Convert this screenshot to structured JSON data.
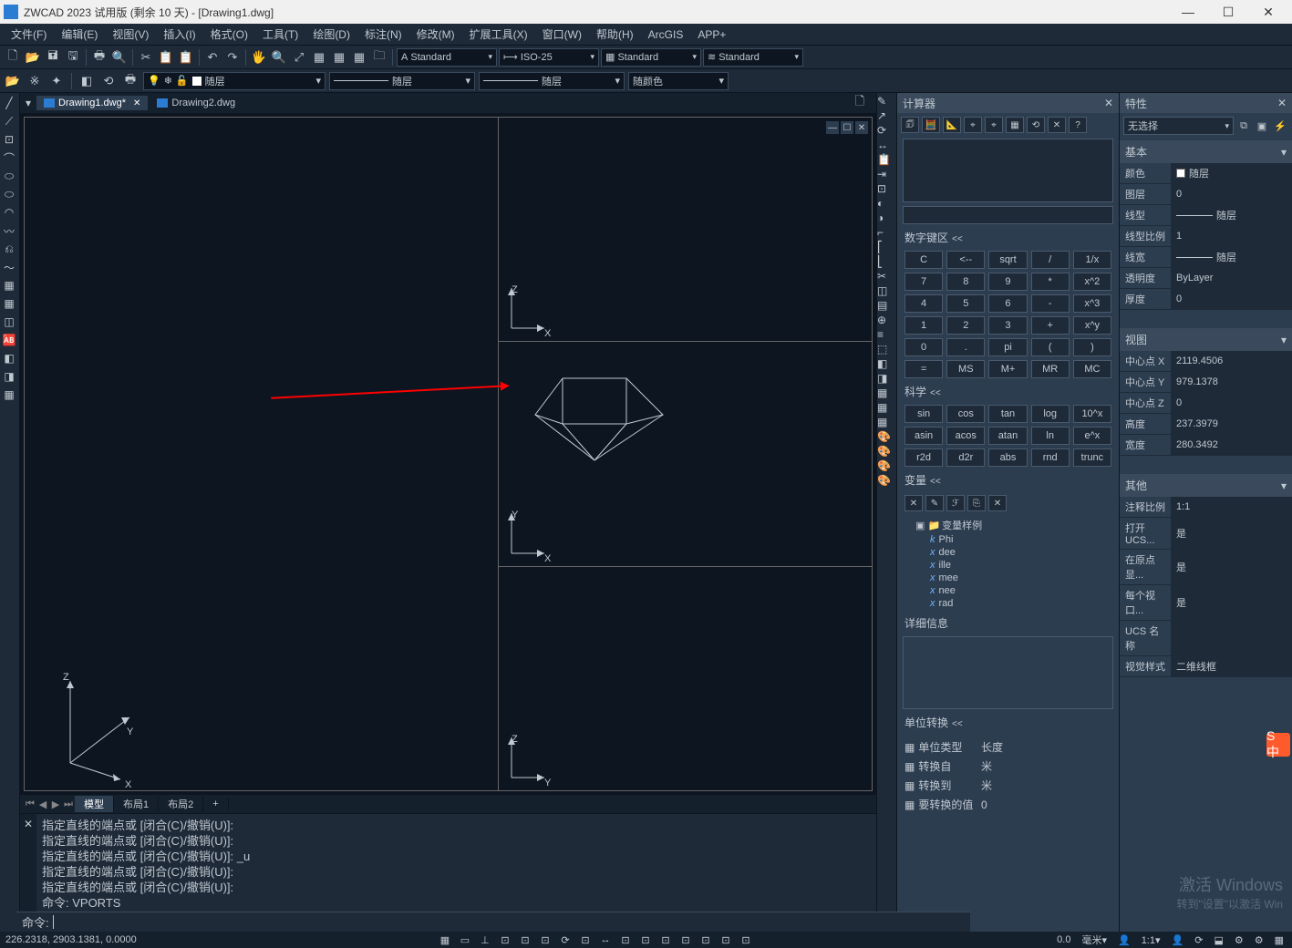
{
  "title": "ZWCAD 2023 试用版 (剩余 10 天) - [Drawing1.dwg]",
  "win_controls": {
    "min": "—",
    "max": "☐",
    "close": "✕"
  },
  "menu": [
    "文件(F)",
    "编辑(E)",
    "视图(V)",
    "插入(I)",
    "格式(O)",
    "工具(T)",
    "绘图(D)",
    "标注(N)",
    "修改(M)",
    "扩展工具(X)",
    "窗口(W)",
    "帮助(H)",
    "ArcGIS",
    "APP+"
  ],
  "toolbar": {
    "row1": [
      "🗋",
      "📂",
      "🖬",
      "🖫",
      "  ",
      "🖶",
      "🔍",
      "  ",
      "✂",
      "📋",
      "📋",
      "  ",
      "↶",
      "↷",
      "  ",
      "🖐",
      "🔍",
      "⤢",
      "▦",
      "▦",
      "▦",
      "🗀",
      "  "
    ],
    "style": {
      "txt": "Standard",
      "dim": "ISO-25",
      "tbl": "Standard",
      "ml": "Standard"
    }
  },
  "layer_row": {
    "layer": "随层",
    "linetype": "随层",
    "lineweight": "随层",
    "color": "随颜色"
  },
  "doc_tabs": {
    "active": "Drawing1.dwg*",
    "inactive": "Drawing2.dwg"
  },
  "layout_tabs": {
    "active": "模型",
    "others": [
      "布局1",
      "布局2"
    ],
    "add": "+"
  },
  "axis": {
    "x": "X",
    "y": "Y",
    "z": "Z"
  },
  "cmd_history": [
    "指定直线的端点或 [闭合(C)/撤销(U)]:",
    "指定直线的端点或 [闭合(C)/撤销(U)]:",
    "指定直线的端点或 [闭合(C)/撤销(U)]: _u",
    "指定直线的端点或 [闭合(C)/撤销(U)]:",
    "指定直线的端点或 [闭合(C)/撤销(U)]:",
    "命令: VPORTS"
  ],
  "cmd_prompt": "命令: ",
  "calc": {
    "title": "计算器",
    "icon_hints": [
      "🗊",
      "🧮",
      "📐",
      "⌖",
      "⌖",
      "▦",
      "⟲",
      "✕",
      "?"
    ],
    "numpad_title": "数字键区",
    "numpad": [
      [
        "C",
        "<--",
        "sqrt",
        "/",
        "1/x"
      ],
      [
        "7",
        "8",
        "9",
        "*",
        "x^2"
      ],
      [
        "4",
        "5",
        "6",
        "-",
        "x^3"
      ],
      [
        "1",
        "2",
        "3",
        "+",
        "x^y"
      ],
      [
        "0",
        ".",
        "pi",
        "(",
        ")"
      ],
      [
        "=",
        "MS",
        "M+",
        "MR",
        "MC"
      ]
    ],
    "sci_title": "科学",
    "sci": [
      [
        "sin",
        "cos",
        "tan",
        "log",
        "10^x"
      ],
      [
        "asin",
        "acos",
        "atan",
        "ln",
        "e^x"
      ],
      [
        "r2d",
        "d2r",
        "abs",
        "rnd",
        "trunc"
      ]
    ],
    "var_title": "变量",
    "var_toolbar": [
      "✕",
      "✎",
      "ℱ",
      "⎘",
      "✕"
    ],
    "var_root": "变量样例",
    "vars": [
      "Phi",
      "dee",
      "ille",
      "mee",
      "nee",
      "rad"
    ],
    "detail_title": "详细信息",
    "unit_title": "单位转换",
    "unit_rows": [
      {
        "label": "单位类型",
        "value": "长度"
      },
      {
        "label": "转换自",
        "value": "米"
      },
      {
        "label": "转换到",
        "value": "米"
      },
      {
        "label": "要转换的值",
        "value": "0"
      }
    ]
  },
  "props": {
    "title": "特性",
    "select": "无选择",
    "sections": {
      "basic": {
        "title": "基本",
        "rows": [
          {
            "label": "颜色",
            "value": "随层",
            "swatch": true
          },
          {
            "label": "图层",
            "value": "0"
          },
          {
            "label": "线型",
            "value": "随层",
            "line": true
          },
          {
            "label": "线型比例",
            "value": "1"
          },
          {
            "label": "线宽",
            "value": "随层",
            "line": true
          },
          {
            "label": "透明度",
            "value": "ByLayer"
          },
          {
            "label": "厚度",
            "value": "0"
          }
        ]
      },
      "view": {
        "title": "视图",
        "rows": [
          {
            "label": "中心点 X",
            "value": "2119.4506"
          },
          {
            "label": "中心点 Y",
            "value": "979.1378"
          },
          {
            "label": "中心点 Z",
            "value": "0"
          },
          {
            "label": "高度",
            "value": "237.3979"
          },
          {
            "label": "宽度",
            "value": "280.3492"
          }
        ]
      },
      "other": {
        "title": "其他",
        "rows": [
          {
            "label": "注释比例",
            "value": "1:1"
          },
          {
            "label": "打开 UCS...",
            "value": "是"
          },
          {
            "label": "在原点显...",
            "value": "是"
          },
          {
            "label": "每个视口...",
            "value": "是"
          },
          {
            "label": "UCS 名称",
            "value": ""
          },
          {
            "label": "视觉样式",
            "value": "二维线框"
          }
        ]
      }
    }
  },
  "status": {
    "coords": "226.2318, 2903.1381, 0.0000",
    "right_items": [
      "0.0",
      "毫米",
      "▾",
      "1:1",
      "▾"
    ]
  },
  "watermark": {
    "l1": "激活 Windows",
    "l2": "转到\"设置\"以激活 Win"
  },
  "ime": "S 中",
  "collapse_marker": "<<"
}
